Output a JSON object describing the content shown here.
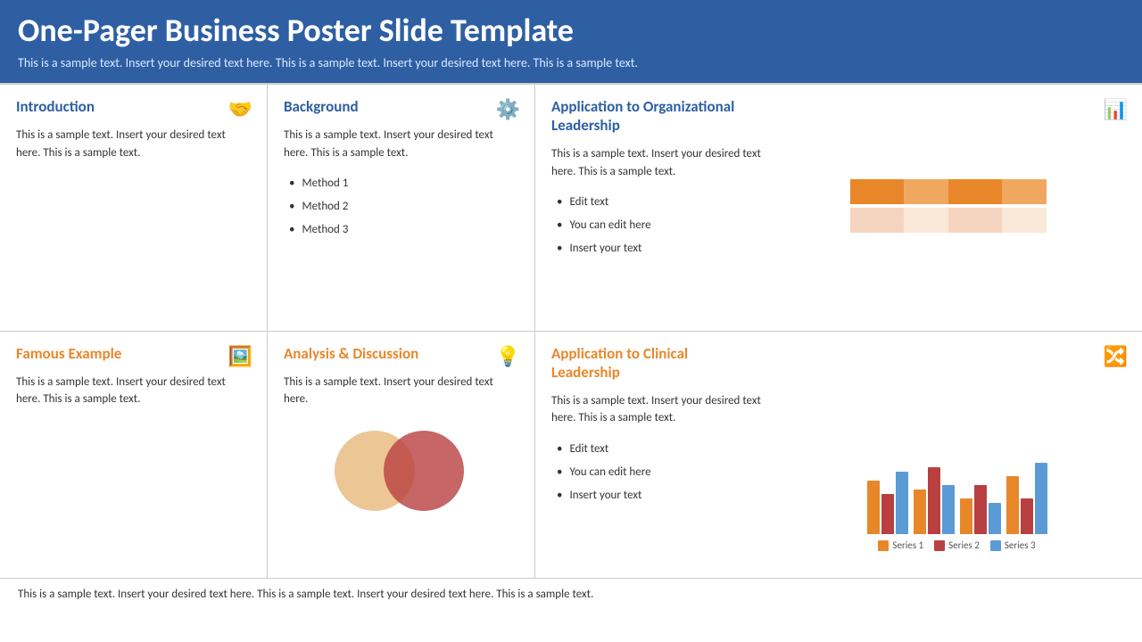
{
  "header": {
    "title": "One-Pager Business Poster Slide Template",
    "subtitle": "This is a sample text. Insert your desired text here. This is a sample text. Insert your desired text here. This is a sample text."
  },
  "footer": {
    "text": "This is a sample text. Insert your desired text here. This is a sample text. Insert your desired text here. This is a sample text."
  },
  "sections": {
    "introduction": {
      "title": "Introduction",
      "body": "This is a sample text. Insert your desired text here. This is a sample text.",
      "icon": "🤝"
    },
    "background": {
      "title": "Background",
      "body": "This is a sample text. Insert your desired text here. This is a sample text.",
      "icon": "⚙️",
      "bullets": [
        "Method 1",
        "Method 2",
        "Method 3"
      ]
    },
    "application_org": {
      "title": "Application to Organizational Leadership",
      "body": "This is a sample text. Insert your desired text here. This is a sample text.",
      "icon": "📊",
      "bullets": [
        "Edit text",
        "You can edit here",
        "Insert your text"
      ]
    },
    "famous_example": {
      "title": "Famous Example",
      "body": "This is a sample text. Insert your desired text here. This is a sample text.",
      "icon": "🖼️"
    },
    "analysis": {
      "title": "Analysis & Discussion",
      "body": "This is a sample text. Insert your desired text here.",
      "icon": "💡"
    },
    "application_clinical": {
      "title": "Application to Clinical Leadership",
      "body": "This is a sample text. Insert your desired text here. This is a sample text.",
      "icon": "🔀",
      "bullets": [
        "Edit text",
        "You can edit here",
        "Insert your text"
      ],
      "legend": [
        "Series 1",
        "Series 2",
        "Series 3"
      ]
    }
  },
  "hbar": {
    "rows": [
      {
        "segments": [
          {
            "width": 65,
            "color": "#E8872A"
          },
          {
            "width": 55,
            "color": "#F0A860"
          },
          {
            "width": 65,
            "color": "#E8872A"
          },
          {
            "width": 55,
            "color": "#F0A860"
          }
        ]
      },
      {
        "segments": [
          {
            "width": 65,
            "color": "#F5D5C0"
          },
          {
            "width": 55,
            "color": "#FAE8D8"
          },
          {
            "width": 65,
            "color": "#F5D5C0"
          },
          {
            "width": 55,
            "color": "#FAE8D8"
          }
        ]
      }
    ]
  },
  "grouped_bars": [
    {
      "s1": 60,
      "s2": 45,
      "s3": 70
    },
    {
      "s1": 50,
      "s2": 75,
      "s3": 55
    },
    {
      "s1": 40,
      "s2": 55,
      "s3": 35
    },
    {
      "s1": 65,
      "s2": 40,
      "s3": 80
    }
  ]
}
